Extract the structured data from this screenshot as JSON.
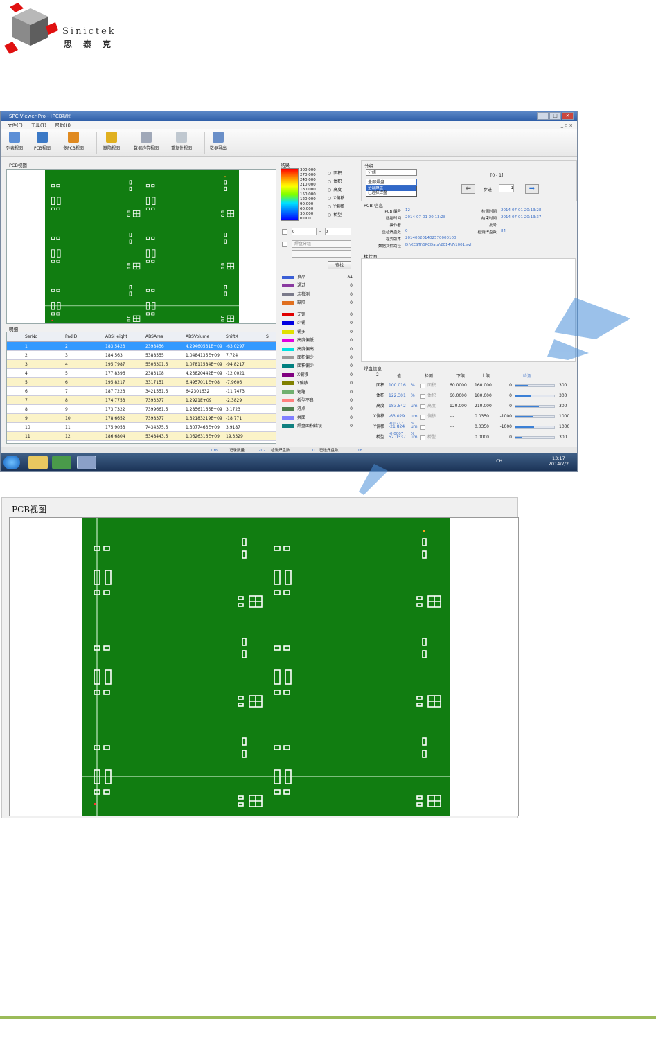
{
  "document": {
    "brand_en": "Sinictek",
    "brand_cn": "思泰克"
  },
  "app": {
    "title": "SPC Viewer Pro - [PCB视图]",
    "menu": [
      "文件(F)",
      "工具(T)",
      "帮助(H)"
    ],
    "toolbar": [
      "列表视图",
      "PCB视图",
      "多PCB视图",
      "缺陷视图",
      "数据趋势视图",
      "重复性视图",
      "数据导出"
    ],
    "pcb_panel_title": "PCB视图",
    "detail_title": "明细",
    "detail_columns": [
      "SerNo",
      "PadID",
      "ABSHeight",
      "ABSArea",
      "ABSVolume",
      "ShiftX",
      "S"
    ],
    "detail_rows": [
      [
        "1",
        "2",
        "183.5423",
        "2398456",
        "4.29460531E+09",
        "-63.0297"
      ],
      [
        "2",
        "3",
        "184.563",
        "5388555",
        "1.0484135E+09",
        "7.724"
      ],
      [
        "3",
        "4",
        "195.7987",
        "5506301.5",
        "1.07811584E+09",
        "-94.8217"
      ],
      [
        "4",
        "5",
        "177.8396",
        "2383108",
        "4.23820442E+09",
        "-12.0021"
      ],
      [
        "5",
        "6",
        "195.8217",
        "3317151",
        "6.4957011E+08",
        "-7.9606"
      ],
      [
        "6",
        "7",
        "187.7223",
        "3421551.5",
        "642301632",
        "-11.7473"
      ],
      [
        "7",
        "8",
        "174.7753",
        "7393377",
        "1.2921E+09",
        "-2.3829"
      ],
      [
        "8",
        "9",
        "173.7322",
        "7399661.5",
        "1.28561165E+09",
        "3.1723"
      ],
      [
        "9",
        "10",
        "178.6652",
        "7398377",
        "1.32183219E+09",
        "-18.771"
      ],
      [
        "10",
        "11",
        "175.9053",
        "7434375.5",
        "1.3077463E+09",
        "3.9187"
      ],
      [
        "11",
        "12",
        "186.6804",
        "5348443.5",
        "1.0626316E+09",
        "19.3329"
      ]
    ],
    "result_title": "结果",
    "gradient_labels": [
      "300.000",
      "270.000",
      "240.000",
      "210.000",
      "180.000",
      "150.000",
      "120.000",
      "90.000",
      "60.000",
      "30.000",
      "0.000"
    ],
    "result_modes": [
      "面积",
      "体积",
      "高度",
      "X偏移",
      "Y偏移",
      "桥型"
    ],
    "filter": {
      "from": "0",
      "to": "0",
      "group_placeholder": "焊盘分组",
      "search_label": "查找"
    },
    "status_legend": [
      {
        "label": "良品",
        "count": "84",
        "color": "#3b5fd6"
      },
      {
        "label": "通过",
        "count": "0",
        "color": "#8a3aa0"
      },
      {
        "label": "未检测",
        "count": "0",
        "color": "#7a7a8a"
      },
      {
        "label": "缺陷",
        "count": "0",
        "color": "#e07020"
      }
    ],
    "defect_legend": [
      {
        "label": "无锡",
        "count": "0",
        "color": "#e00000"
      },
      {
        "label": "少锡",
        "count": "0",
        "color": "#0000e0"
      },
      {
        "label": "锡多",
        "count": "0",
        "color": "#e0e000"
      },
      {
        "label": "高度偏低",
        "count": "0",
        "color": "#e000e0"
      },
      {
        "label": "高度偏高",
        "count": "0",
        "color": "#00e0e0"
      },
      {
        "label": "面积偏少",
        "count": "0",
        "color": "#9a9a9a"
      },
      {
        "label": "面积偏少",
        "count": "0",
        "color": "#008080"
      },
      {
        "label": "X偏移",
        "count": "0",
        "color": "#800080"
      },
      {
        "label": "Y偏移",
        "count": "0",
        "color": "#808000"
      },
      {
        "label": "短路",
        "count": "0",
        "color": "#70b070"
      },
      {
        "label": "桥型不良",
        "count": "0",
        "color": "#ff8080"
      },
      {
        "label": "污点",
        "count": "0",
        "color": "#508050"
      },
      {
        "label": "共面",
        "count": "0",
        "color": "#8080ff"
      },
      {
        "label": "焊盘面积错误",
        "count": "0",
        "color": "#108080"
      }
    ],
    "group": {
      "title": "分组",
      "select1": "分组一",
      "select2": "全部焊盘",
      "options": [
        "全部焊盘",
        "已选择焊盘"
      ],
      "range": "[0 - 1]",
      "step_label": "步进",
      "step_value": "1"
    },
    "pcb_info": {
      "title": "PCB 信息",
      "fields": [
        {
          "label": "PCB 编号",
          "value": "12"
        },
        {
          "label": "起始时间",
          "value": "2014-07-01 20:13:28"
        },
        {
          "label": "操作者",
          "value": ""
        },
        {
          "label": "重检焊盘数",
          "value": "0"
        },
        {
          "label": "程式版本",
          "value": "201406201402570000100"
        },
        {
          "label": "数据文件路径",
          "value": "D:\\KESTI\\SPCData\\2014\\7\\1001.svl"
        }
      ],
      "fields_right": [
        {
          "label": "检测时间",
          "value": "2014-07-01 20:13:28"
        },
        {
          "label": "结束时间",
          "value": "2014-07-01 20:13:37"
        },
        {
          "label": "批号",
          "value": ""
        },
        {
          "label": "检测焊盘数",
          "value": "84"
        }
      ]
    },
    "histogram_title": "柱状图",
    "pad_info": {
      "title": "焊盘信息",
      "pad_no": "2",
      "headers": [
        "值",
        "检测",
        "下限",
        "上限",
        "检测"
      ],
      "rows": [
        {
          "name": "面积",
          "value": "100.016",
          "unit": "%",
          "check": "面积",
          "low": "60.0000",
          "high": "160.000",
          "min": "0",
          "max": "300",
          "fill": 0.33
        },
        {
          "name": "体积",
          "value": "122.301",
          "unit": "%",
          "check": "体积",
          "low": "60.0000",
          "high": "180.000",
          "min": "0",
          "max": "300",
          "fill": 0.41
        },
        {
          "name": "高度",
          "value": "183.542",
          "unit": "um",
          "check": "高度",
          "low": "120.000",
          "high": "210.000",
          "min": "0",
          "max": "300",
          "fill": 0.61
        },
        {
          "name": "X偏移",
          "value": "-63.029",
          "unit": "um",
          "check": "偏移",
          "low": "---",
          "high": "0.0350",
          "min": "-1000",
          "max": "1000",
          "fill": 0.47
        },
        {
          "name": "Y偏移",
          "value": "-21.824",
          "unit": "um",
          "check": "",
          "low": "---",
          "high": "0.0350",
          "min": "-1000",
          "max": "1000",
          "fill": 0.49
        },
        {
          "name": "桥型",
          "value": "52.0337",
          "unit": "um",
          "check": "桥型",
          "low": "",
          "high": "0.0000",
          "min": "0",
          "max": "300",
          "fill": 0.17
        }
      ],
      "sub_values": [
        "-0.0217",
        "-0.0007"
      ],
      "sub_units": [
        "%",
        "%"
      ]
    },
    "statusbar": {
      "unit": "um",
      "record_label": "记录数量",
      "record_value": "202",
      "detected_label": "检测焊盘数",
      "detected_value": "0",
      "selected_label": "已选焊盘数",
      "selected_value": "18"
    },
    "taskbar": {
      "lang": "CH",
      "time": "13:17",
      "date": "2014/7/2"
    }
  },
  "zoom_panel_title": "PCB视图",
  "colors": {
    "board": "#117d11",
    "title_bar": "#2f5fa8",
    "accent": "#3b80d6",
    "footer_rule": "#9bbb59"
  }
}
